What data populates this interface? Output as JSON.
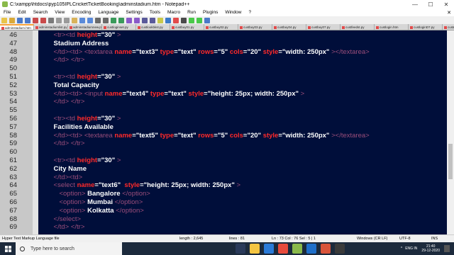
{
  "window": {
    "title": "C:\\xampp\\htdocs\\pyp105IPLCricketTicketBooking\\adminstadium.htm - Notepad++",
    "minimize": "—",
    "maximize": "☐",
    "close": "✕"
  },
  "menu": [
    "File",
    "Edit",
    "Search",
    "View",
    "Encoding",
    "Language",
    "Settings",
    "Tools",
    "Macro",
    "Run",
    "Plugins",
    "Window",
    "?"
  ],
  "menu_close": "✕",
  "tabs": [
    "adminstadium.htm",
    "adminstadiumlist.py",
    "adminstadiumnew.py",
    "custloginset.py",
    "custlookbkst.py",
    "custbuy01.py",
    "custbuy02.py",
    "custbuy03.py",
    "custbuy04.py",
    "custbuy07.py",
    "custfeedst.py",
    "custlogin.htm",
    "custloginD7.py",
    "custmain.htm"
  ],
  "editor_lines": [
    {
      "n": "46",
      "parts": [
        [
          "dim",
          "    <tr><td "
        ],
        [
          "attr",
          "height"
        ],
        [
          "val",
          "=\"30\""
        ],
        [
          "dim",
          " >"
        ]
      ]
    },
    {
      "n": "47",
      "parts": [
        [
          "txt",
          "    Stadium Address"
        ]
      ]
    },
    {
      "n": "48",
      "parts": [
        [
          "dim",
          "    </td><td> "
        ],
        [
          "dim",
          "<textarea "
        ],
        [
          "attr",
          "name"
        ],
        [
          "val",
          "=\"text3\" "
        ],
        [
          "attr",
          "type"
        ],
        [
          "val",
          "=\"text\" "
        ],
        [
          "attr",
          "rows"
        ],
        [
          "val",
          "=\"5\" "
        ],
        [
          "attr",
          "cols"
        ],
        [
          "val",
          "=\"20\" "
        ],
        [
          "attr",
          "style"
        ],
        [
          "val",
          "=\"width: 250px\""
        ],
        [
          "dim",
          " ></textarea>"
        ]
      ]
    },
    {
      "n": "49",
      "parts": [
        [
          "dim",
          "    </td> </tr>"
        ]
      ]
    },
    {
      "n": "50",
      "parts": []
    },
    {
      "n": "51",
      "parts": [
        [
          "dim",
          "    <tr><td "
        ],
        [
          "attr",
          "height"
        ],
        [
          "val",
          "=\"30\""
        ],
        [
          "dim",
          " >"
        ]
      ]
    },
    {
      "n": "52",
      "parts": [
        [
          "txt",
          "    Total Capacity"
        ]
      ]
    },
    {
      "n": "53",
      "parts": [
        [
          "dim",
          "    </td><td> "
        ],
        [
          "dim",
          "<input "
        ],
        [
          "attr",
          "name"
        ],
        [
          "val",
          "=\"text4\" "
        ],
        [
          "attr",
          "type"
        ],
        [
          "val",
          "=\"text\" "
        ],
        [
          "attr",
          "style"
        ],
        [
          "val",
          "=\"height: 25px; width: 250px\""
        ],
        [
          "dim",
          " >"
        ]
      ]
    },
    {
      "n": "54",
      "parts": [
        [
          "dim",
          "    </td> </tr>"
        ]
      ]
    },
    {
      "n": "55",
      "parts": []
    },
    {
      "n": "56",
      "parts": [
        [
          "dim",
          "    <tr><td "
        ],
        [
          "attr",
          "height"
        ],
        [
          "val",
          "=\"30\""
        ],
        [
          "dim",
          " >"
        ]
      ]
    },
    {
      "n": "57",
      "parts": [
        [
          "txt",
          "    Facilities Available"
        ]
      ]
    },
    {
      "n": "58",
      "parts": [
        [
          "dim",
          "    </td><td> "
        ],
        [
          "dim",
          "<textarea "
        ],
        [
          "attr",
          "name"
        ],
        [
          "val",
          "=\"text5\" "
        ],
        [
          "attr",
          "type"
        ],
        [
          "val",
          "=\"text\" "
        ],
        [
          "attr",
          "rows"
        ],
        [
          "val",
          "=\"5\" "
        ],
        [
          "attr",
          "cols"
        ],
        [
          "val",
          "=\"20\" "
        ],
        [
          "attr",
          "style"
        ],
        [
          "val",
          "=\"width: 250px\""
        ],
        [
          "dim",
          " ></textarea>"
        ]
      ]
    },
    {
      "n": "59",
      "parts": [
        [
          "dim",
          "    </td> </tr>"
        ]
      ]
    },
    {
      "n": "60",
      "parts": []
    },
    {
      "n": "61",
      "parts": [
        [
          "dim",
          "    <tr><td "
        ],
        [
          "attr",
          "height"
        ],
        [
          "val",
          "=\"30\""
        ],
        [
          "dim",
          " >"
        ]
      ]
    },
    {
      "n": "62",
      "parts": [
        [
          "txt",
          "    City Name"
        ]
      ]
    },
    {
      "n": "63",
      "parts": [
        [
          "dim",
          "    </td><td>"
        ]
      ]
    },
    {
      "n": "64",
      "parts": [
        [
          "dim",
          "    <select "
        ],
        [
          "attr",
          "name"
        ],
        [
          "val",
          "=\"text6\"  "
        ],
        [
          "attr",
          "style"
        ],
        [
          "val",
          "=\"height: 25px; width: 250px\""
        ],
        [
          "dim",
          " >"
        ]
      ]
    },
    {
      "n": "65",
      "parts": [
        [
          "dim",
          "       <option> "
        ],
        [
          "txt",
          "Bangalore"
        ],
        [
          "dim",
          " </option>"
        ]
      ]
    },
    {
      "n": "66",
      "parts": [
        [
          "dim",
          "       <option> "
        ],
        [
          "txt",
          "Mumbai"
        ],
        [
          "dim",
          " </option>"
        ]
      ]
    },
    {
      "n": "67",
      "parts": [
        [
          "dim",
          "       <option> "
        ],
        [
          "txt",
          "Kolkatta"
        ],
        [
          "dim",
          " </option>"
        ]
      ]
    },
    {
      "n": "68",
      "parts": [
        [
          "dim",
          "    </select>"
        ]
      ]
    },
    {
      "n": "69",
      "parts": [
        [
          "dim",
          "    </td> </tr>"
        ]
      ]
    }
  ],
  "status": {
    "file_type": "Hyper Text Markup Language file",
    "length": "length : 2,645",
    "lines": "lines : 81",
    "position": "Ln : 73   Col : 76   Sel : 5 | 1",
    "eol": "Windows (CR LF)",
    "encoding": "UTF-8",
    "mode": "INS"
  },
  "taskbar": {
    "search_placeholder": "Type here to search",
    "language": "ENG",
    "region": "IN",
    "time": "21:40",
    "date": "29-12-2020"
  },
  "colors": {
    "editor_bg": "#000e3a",
    "tag": "#ff3c3c",
    "attr": "#ff2a2a",
    "text": "#ffffff",
    "dim_tag": "#9a4d7a",
    "active_tab_accent": "#f7a23a"
  }
}
